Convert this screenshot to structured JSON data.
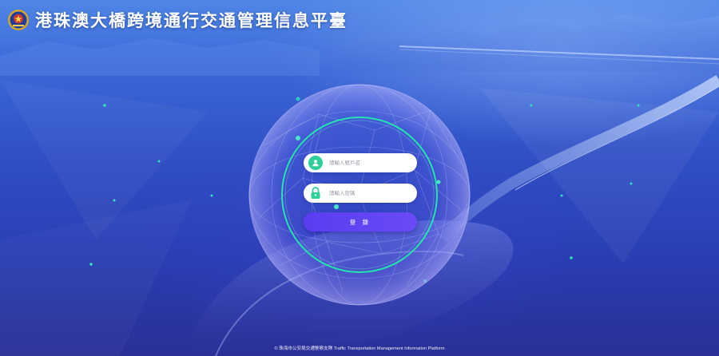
{
  "header": {
    "title": "港珠澳大橋跨境通行交通管理信息平臺",
    "emblem_icon": "police-emblem-icon"
  },
  "login": {
    "username_placeholder": "請輸入賬戶名",
    "password_placeholder": "請輸入密碼",
    "submit_label": "登 錄",
    "user_icon": "user-icon",
    "lock_icon": "lock-icon"
  },
  "footer": {
    "copyright": "© 珠海市公安局交通警察支隊 Traffic Transportation Management Information Platform"
  },
  "colors": {
    "accent_green": "#2ecf9a",
    "button_purple": "#5b3ff2",
    "bg_blue": "#2f4fc4"
  }
}
